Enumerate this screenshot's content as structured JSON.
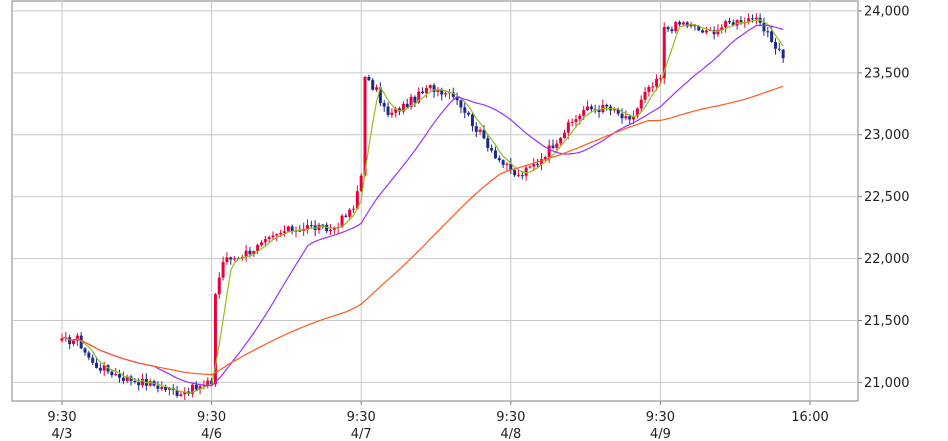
{
  "chart_data": {
    "type": "candlestick",
    "title": "",
    "xlabel": "",
    "ylabel": "",
    "ylim": [
      20850,
      24080
    ],
    "y_ticks": [
      "21,000",
      "21,500",
      "22,000",
      "22,500",
      "23,000",
      "23,500",
      "24,000"
    ],
    "y_tick_values": [
      21000,
      21500,
      22000,
      22500,
      23000,
      23500,
      24000
    ],
    "grid": true,
    "x_tick_labels": [
      {
        "time": "9:30",
        "date": "4/3",
        "bar": 0
      },
      {
        "time": "9:30",
        "date": "4/6",
        "bar": 39
      },
      {
        "time": "9:30",
        "date": "4/7",
        "bar": 78
      },
      {
        "time": "9:30",
        "date": "4/8",
        "bar": 117
      },
      {
        "time": "9:30",
        "date": "4/9",
        "bar": 156
      },
      {
        "time": "16:00",
        "date": "",
        "bar": 195
      }
    ],
    "anchors": [
      [
        0,
        21330
      ],
      [
        4,
        21350
      ],
      [
        8,
        21150
      ],
      [
        16,
        21040
      ],
      [
        24,
        20980
      ],
      [
        30,
        20920
      ],
      [
        36,
        20960
      ],
      [
        39,
        21000
      ],
      [
        40,
        21720
      ],
      [
        42,
        21980
      ],
      [
        46,
        22020
      ],
      [
        52,
        22110
      ],
      [
        58,
        22220
      ],
      [
        64,
        22260
      ],
      [
        70,
        22230
      ],
      [
        76,
        22400
      ],
      [
        78,
        22700
      ],
      [
        79,
        23450
      ],
      [
        82,
        23350
      ],
      [
        85,
        23150
      ],
      [
        90,
        23250
      ],
      [
        96,
        23380
      ],
      [
        102,
        23340
      ],
      [
        108,
        23050
      ],
      [
        114,
        22800
      ],
      [
        117,
        22700
      ],
      [
        119,
        22660
      ],
      [
        124,
        22780
      ],
      [
        130,
        23000
      ],
      [
        136,
        23200
      ],
      [
        142,
        23220
      ],
      [
        148,
        23100
      ],
      [
        152,
        23330
      ],
      [
        156,
        23450
      ],
      [
        157,
        23850
      ],
      [
        162,
        23900
      ],
      [
        168,
        23820
      ],
      [
        174,
        23900
      ],
      [
        180,
        23950
      ],
      [
        184,
        23800
      ],
      [
        188,
        23640
      ]
    ],
    "noise_seed": 17,
    "candle_colors": {
      "up": "#e8003c",
      "down": "#1a2a8c"
    },
    "moving_averages": [
      {
        "period": 5,
        "color": "#8ec020"
      },
      {
        "period": 25,
        "color": "#9b30ff"
      },
      {
        "period": 75,
        "color": "#ff5a1e"
      }
    ],
    "axis_color": "#808080",
    "grid_color": "#c8c8c8",
    "background": "#ffffff"
  }
}
